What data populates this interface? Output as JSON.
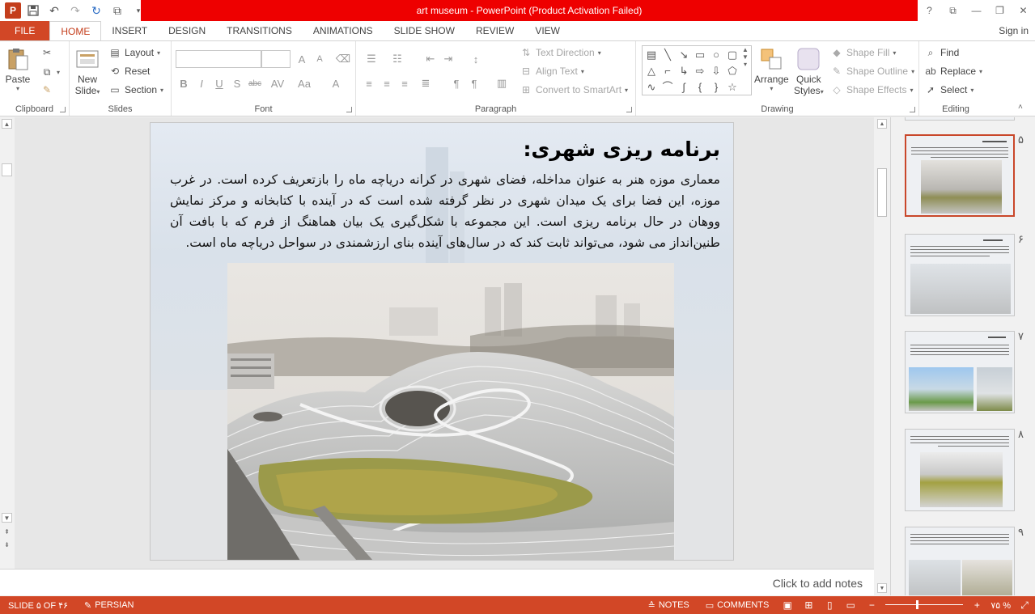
{
  "app": {
    "title": "art museum -  PowerPoint (Product Activation Failed)",
    "logo_letter": "P"
  },
  "window_controls": [
    "?",
    "⧉",
    "—",
    "❐",
    "✕"
  ],
  "tabs": [
    {
      "label": "FILE"
    },
    {
      "label": "HOME"
    },
    {
      "label": "INSERT"
    },
    {
      "label": "DESIGN"
    },
    {
      "label": "TRANSITIONS"
    },
    {
      "label": "ANIMATIONS"
    },
    {
      "label": "SLIDE SHOW"
    },
    {
      "label": "REVIEW"
    },
    {
      "label": "VIEW"
    }
  ],
  "signin": "Sign in",
  "ribbon": {
    "clipboard": {
      "label": "Clipboard",
      "paste": "Paste"
    },
    "slides": {
      "label": "Slides",
      "new_slide_1": "New",
      "new_slide_2": "Slide",
      "layout": "Layout",
      "reset": "Reset",
      "section": "Section"
    },
    "font": {
      "label": "Font"
    },
    "paragraph": {
      "label": "Paragraph",
      "text_direction": "Text Direction",
      "align_text": "Align Text",
      "convert_smartart": "Convert to SmartArt"
    },
    "drawing": {
      "label": "Drawing",
      "arrange": "Arrange",
      "quick_styles_1": "Quick",
      "quick_styles_2": "Styles",
      "shape_fill": "Shape Fill",
      "shape_outline": "Shape Outline",
      "shape_effects": "Shape Effects"
    },
    "editing": {
      "label": "Editing",
      "find": "Find",
      "replace": "Replace",
      "select": "Select"
    }
  },
  "slide": {
    "title": "برنامه ریزی شهری:",
    "body": "معماری موزه هنر به عنوان مداخله، فضای شهری در کرانه دریاچه ماه را بازتعریف کرده است. در غرب موزه، این فضا برای یک میدان شهری در نظر گرفته شده است که در آینده با کتابخانه و مرکز نمایش ووهان در حال برنامه ریزی است. این مجموعه با شکل‌گیری یک بیان هماهنگ از فرم که با بافت آن طنین‌انداز می شود، می‌تواند ثابت کند که در سال‌های آینده بنای ارزشمندی در سواحل دریاچه ماه است."
  },
  "notes_placeholder": "Click to add notes",
  "thumbnails": [
    {
      "num": "۵",
      "selected": true
    },
    {
      "num": "۶",
      "selected": false
    },
    {
      "num": "۷",
      "selected": false
    },
    {
      "num": "۸",
      "selected": false
    },
    {
      "num": "۹",
      "selected": false
    }
  ],
  "statusbar": {
    "slide_info": "SLIDE ۵ OF ۴۶",
    "language": "PERSIAN",
    "notes": "NOTES",
    "comments": "COMMENTS",
    "zoom": "۷۵ %",
    "zoom_level_fraction": 0.4
  },
  "colors": {
    "accent": "#d24726",
    "title_bar_alert": "#ee0000"
  }
}
